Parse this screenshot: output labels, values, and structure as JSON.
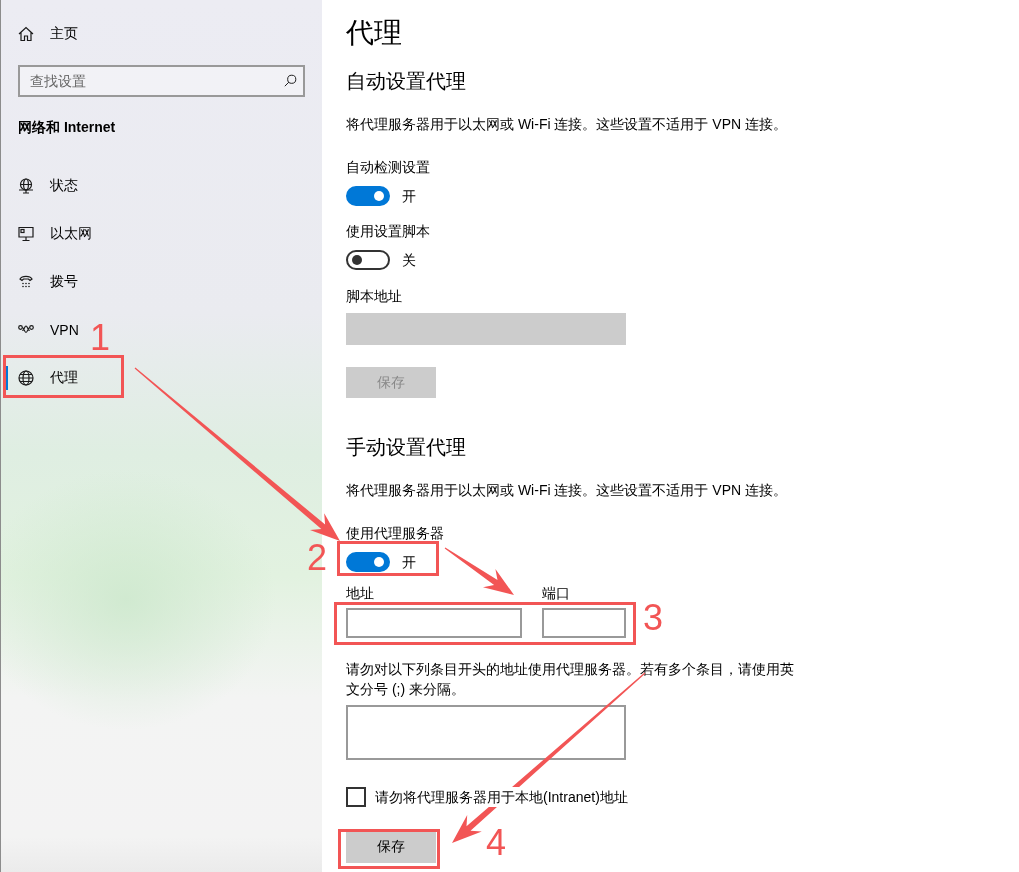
{
  "sidebar": {
    "home": {
      "label": "主页"
    },
    "search": {
      "placeholder": "查找设置"
    },
    "section_title": "网络和 Internet",
    "items": [
      {
        "label": "状态",
        "selected": false
      },
      {
        "label": "以太网",
        "selected": false
      },
      {
        "label": "拨号",
        "selected": false
      },
      {
        "label": "VPN",
        "selected": false
      },
      {
        "label": "代理",
        "selected": true
      }
    ]
  },
  "page": {
    "title": "代理",
    "sections": [
      {
        "heading": "自动设置代理",
        "description": "将代理服务器用于以太网或 Wi-Fi 连接。这些设置不适用于 VPN 连接。",
        "controls": [
          {
            "kind": "toggle",
            "label": "自动检测设置",
            "on": true,
            "state_text": "开"
          },
          {
            "kind": "toggle",
            "label": "使用设置脚本",
            "on": false,
            "state_text": "关"
          },
          {
            "kind": "text_field",
            "label": "脚本地址",
            "disabled": true
          },
          {
            "kind": "button",
            "label": "保存",
            "disabled": true
          }
        ]
      },
      {
        "heading": "手动设置代理",
        "description": "将代理服务器用于以太网或 Wi-Fi 连接。这些设置不适用于 VPN 连接。",
        "controls": [
          {
            "kind": "toggle",
            "label": "使用代理服务器",
            "on": true,
            "state_text": "开"
          },
          {
            "kind": "field_pair",
            "fields": [
              {
                "label": "地址"
              },
              {
                "label": "端口"
              }
            ]
          },
          {
            "kind": "textarea",
            "label": "请勿对以下列条目开头的地址使用代理服务器。若有多个条目，请使用英文分号 (;) 来分隔。"
          },
          {
            "kind": "checkbox",
            "label": "请勿将代理服务器用于本地(Intranet)地址",
            "checked": false
          },
          {
            "kind": "button",
            "label": "保存",
            "disabled": false
          }
        ]
      }
    ]
  },
  "annotations": [
    {
      "label": "1"
    },
    {
      "label": "2"
    },
    {
      "label": "3"
    },
    {
      "label": "4"
    }
  ]
}
